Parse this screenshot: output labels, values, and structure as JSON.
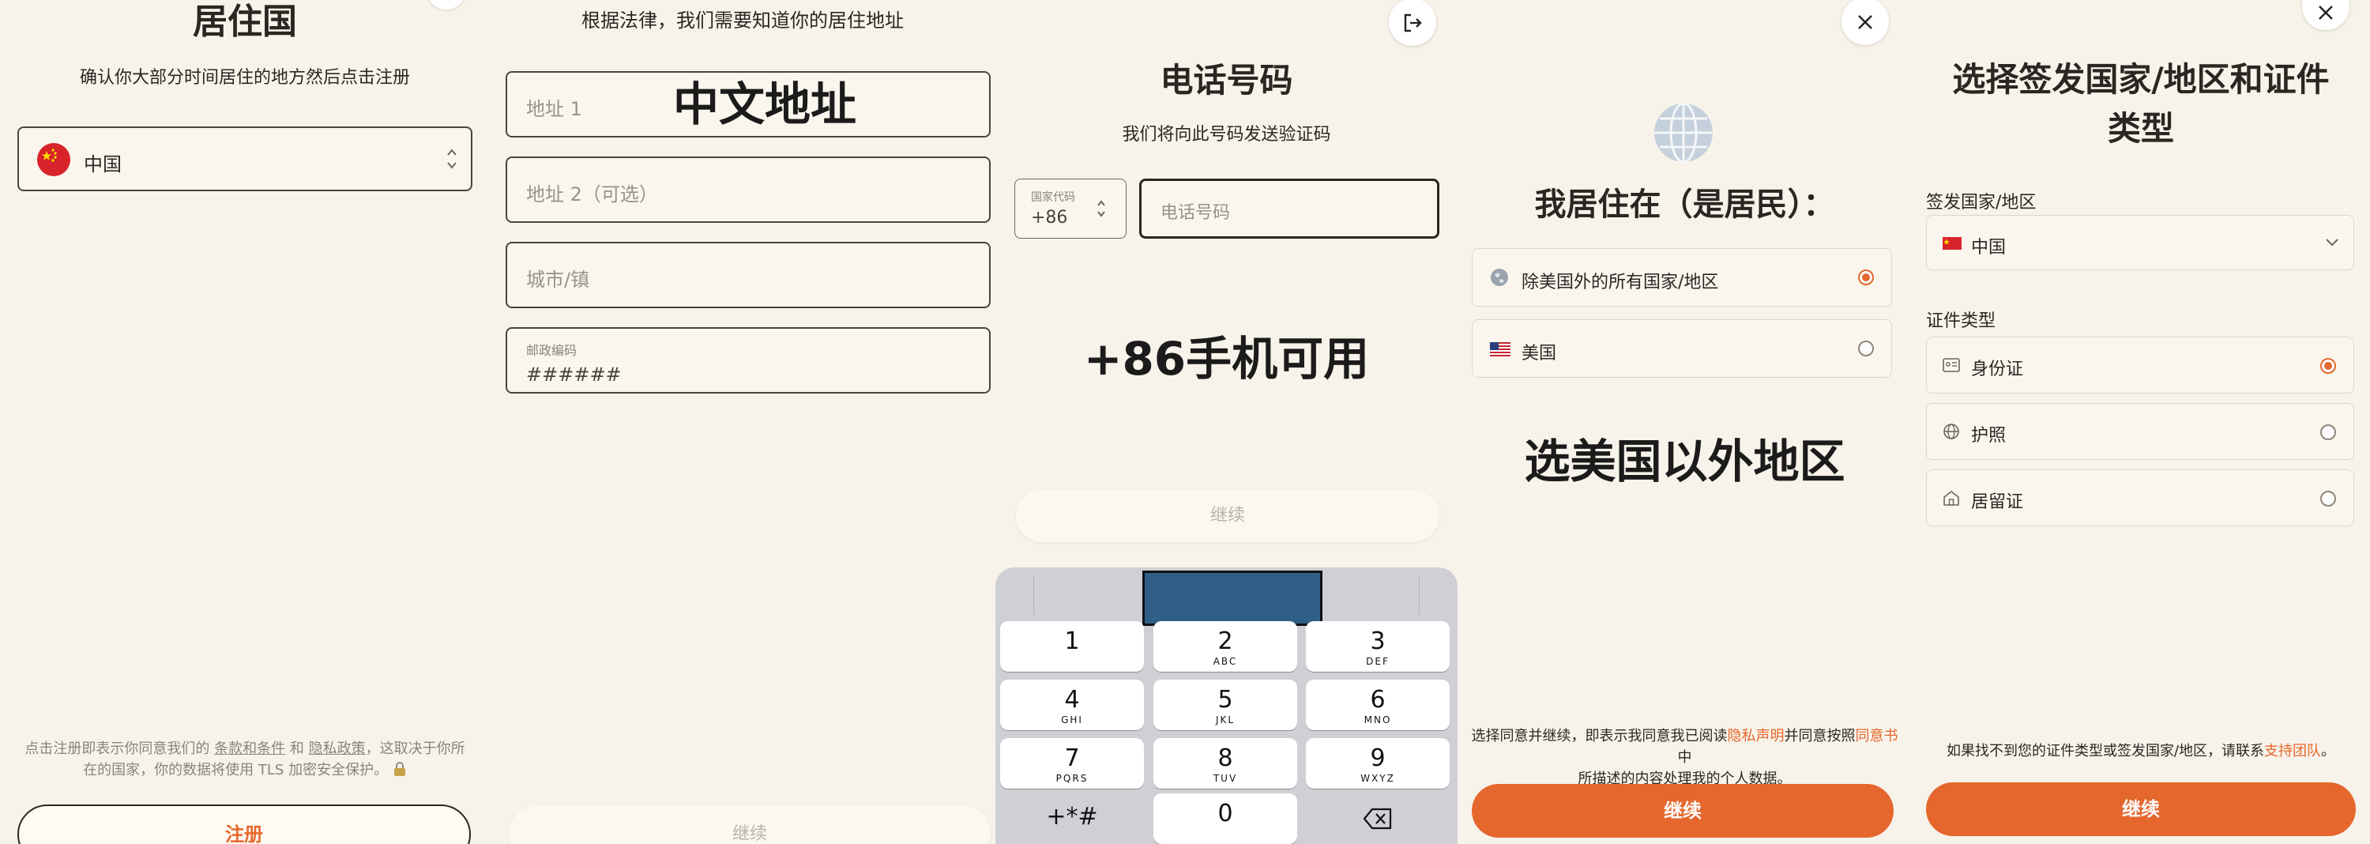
{
  "panel1": {
    "title": "居住国",
    "subtitle": "确认你大部分时间居住的地方然后点击注册",
    "country_value": "中国",
    "footer_part1": "点击注册即表示你同意我们的",
    "footer_terms": "条款和条件",
    "footer_and": "和",
    "footer_privacy": "隐私政策",
    "footer_part2": "，这取决于你所",
    "footer_line2": "在的国家，你的数据将使用 TLS 加密安全保护。",
    "register_label": "注册"
  },
  "panel2": {
    "heading": "根据法律，我们需要知道你的居住地址",
    "address1_placeholder": "地址 1",
    "overlay": "中文地址",
    "address2_placeholder": "地址 2（可选）",
    "city_placeholder": "城市/镇",
    "postal_label": "邮政编码",
    "postal_value": "######",
    "continue_label": "继续"
  },
  "panel3": {
    "title": "电话号码",
    "subtitle": "我们将向此号码发送验证码",
    "country_code_label": "国家代码",
    "country_code_value": "+86",
    "phone_placeholder": "电话号码",
    "overlay": "+86手机可用",
    "continue_label": "继续",
    "keys": [
      {
        "num": "1",
        "letters": ""
      },
      {
        "num": "2",
        "letters": "ABC"
      },
      {
        "num": "3",
        "letters": "DEF"
      },
      {
        "num": "4",
        "letters": "GHI"
      },
      {
        "num": "5",
        "letters": "JKL"
      },
      {
        "num": "6",
        "letters": "MNO"
      },
      {
        "num": "7",
        "letters": "PQRS"
      },
      {
        "num": "8",
        "letters": "TUV"
      },
      {
        "num": "9",
        "letters": "WXYZ"
      },
      {
        "num": "+*#",
        "letters": ""
      },
      {
        "num": "0",
        "letters": ""
      }
    ]
  },
  "panel4": {
    "title": "我居住在（是居民）：",
    "option1": "除美国外的所有国家/地区",
    "option2": "美国",
    "overlay": "选美国以外地区",
    "consent_part1": "选择同意并继续，即表示我同意我已阅读",
    "consent_privacy": "隐私声明",
    "consent_part2": "并同意按照",
    "consent_agreement": "同意书",
    "consent_part3": "中",
    "consent_line2": "所描述的内容处理我的个人数据。",
    "continue_label": "继续"
  },
  "panel5": {
    "title_line1": "选择签发国家/地区和证件",
    "title_line2": "类型",
    "issuing_label": "签发国家/地区",
    "issuing_value": "中国",
    "doc_type_label": "证件类型",
    "doc_options": [
      "身份证",
      "护照",
      "居留证"
    ],
    "help_part1": "如果找不到您的证件类型或签发国家/地区，请联系",
    "help_link": "支持团队",
    "help_end": "。",
    "continue_label": "继续"
  },
  "icons": {
    "updown": "chevron-updown-icon",
    "logout": "logout-icon",
    "close": "close-icon",
    "globe": "globe-icon",
    "lock": "lock-icon",
    "backspace": "backspace-icon"
  },
  "colors": {
    "accent": "#e5672d",
    "background": "#f8f3ea",
    "text": "#2b2622"
  }
}
